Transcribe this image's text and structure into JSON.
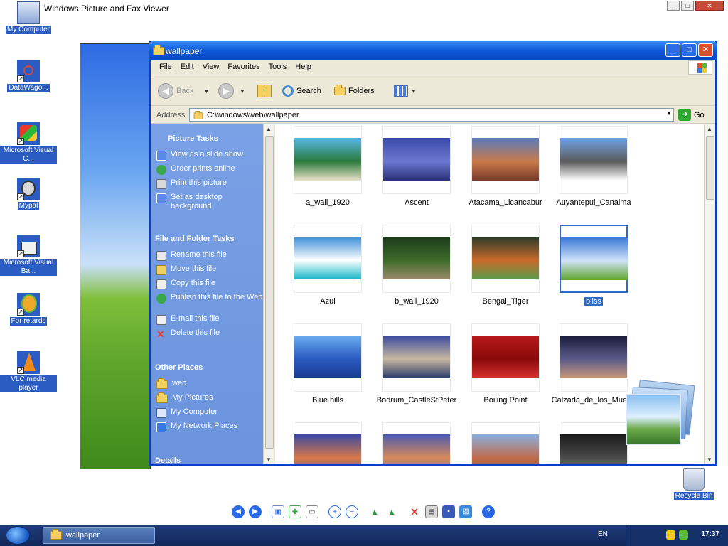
{
  "viewer": {
    "title": "Windows Picture and Fax Viewer"
  },
  "desktop_icons": [
    {
      "label": "My Computer",
      "icon": "my-computer-icon"
    },
    {
      "label": "DataWago...",
      "icon": "datawagon-icon"
    },
    {
      "label": "Microsoft Visual C...",
      "icon": "visual-c-icon"
    },
    {
      "label": "Mypal",
      "icon": "mypal-icon"
    },
    {
      "label": "Microsoft Visual Ba...",
      "icon": "visual-basic-icon"
    },
    {
      "label": "For retards",
      "icon": "for-retards-icon"
    },
    {
      "label": "VLC media player",
      "icon": "vlc-icon"
    }
  ],
  "recycle_bin": {
    "label": "Recycle Bin"
  },
  "explorer": {
    "title": "wallpaper",
    "menu": [
      "File",
      "Edit",
      "View",
      "Favorites",
      "Tools",
      "Help"
    ],
    "toolbar": {
      "back": "Back",
      "search": "Search",
      "folders": "Folders"
    },
    "address": {
      "label": "Address",
      "value": "C:\\windows\\web\\wallpaper",
      "go": "Go"
    },
    "task_pane": {
      "picture_tasks": {
        "header": "Picture Tasks",
        "items": [
          "View as a slide show",
          "Order prints online",
          "Print this picture",
          "Set as desktop background"
        ]
      },
      "file_tasks": {
        "header": "File and Folder Tasks",
        "items": [
          "Rename this file",
          "Move this file",
          "Copy this file",
          "Publish this file to the Web",
          "E-mail this file",
          "Delete this file"
        ]
      },
      "other_places": {
        "header": "Other Places",
        "items": [
          "web",
          "My Pictures",
          "My Computer",
          "My Network Places"
        ]
      },
      "details": {
        "header": "Details"
      }
    },
    "files": [
      {
        "name": "a_wall_1920",
        "colors": [
          "#56b8e6",
          "#2b7a3c",
          "#e9e1c8"
        ]
      },
      {
        "name": "Ascent",
        "colors": [
          "#3b4aa8",
          "#6a78d0",
          "#2a2f7a"
        ]
      },
      {
        "name": "Atacama_Licancabur",
        "colors": [
          "#5a7bbd",
          "#c97a4a",
          "#7a3a2a"
        ]
      },
      {
        "name": "Auyantepui_Canaima",
        "colors": [
          "#6fa2e8",
          "#5b5b5b",
          "#ffffff"
        ]
      },
      {
        "name": "Azul",
        "colors": [
          "#3a8fd8",
          "#ffffff",
          "#17b7c9"
        ]
      },
      {
        "name": "b_wall_1920",
        "colors": [
          "#1c3a1a",
          "#3c6b2a",
          "#9a8a6a"
        ]
      },
      {
        "name": "Bengal_Tiger",
        "colors": [
          "#2a3a2a",
          "#c86a2a",
          "#5a9a4a"
        ]
      },
      {
        "name": "bliss",
        "colors": [
          "#3a78d8",
          "#cfe3f7",
          "#5ea52b"
        ]
      },
      {
        "name": "Blue hills",
        "colors": [
          "#6aaef0",
          "#2a5ac0",
          "#173a90"
        ]
      },
      {
        "name": "Bodrum_CastleStPeter",
        "colors": [
          "#3a4aa0",
          "#c8b8a0",
          "#2a3a6a"
        ]
      },
      {
        "name": "Boiling Point",
        "colors": [
          "#b8181a",
          "#8a0a0a",
          "#d83030"
        ]
      },
      {
        "name": "Calzada_de_los_Muer...",
        "colors": [
          "#1a1a3a",
          "#5a5a8a",
          "#c89a7a"
        ]
      },
      {
        "name": "",
        "colors": [
          "#3a4aa0",
          "#d8784a",
          "#5a5aa8"
        ]
      },
      {
        "name": "",
        "colors": [
          "#4a5ab0",
          "#d88a5a",
          "#6a6ab8"
        ]
      },
      {
        "name": "",
        "colors": [
          "#8ab0e0",
          "#c06a4a",
          "#8a5a4a"
        ]
      },
      {
        "name": "",
        "colors": [
          "#1a1a1a",
          "#4a4a4a",
          "#8a8a8a"
        ]
      }
    ],
    "selected_file": "bliss"
  },
  "taskbar": {
    "task": "wallpaper",
    "lang": "EN",
    "clock": "17:37"
  }
}
